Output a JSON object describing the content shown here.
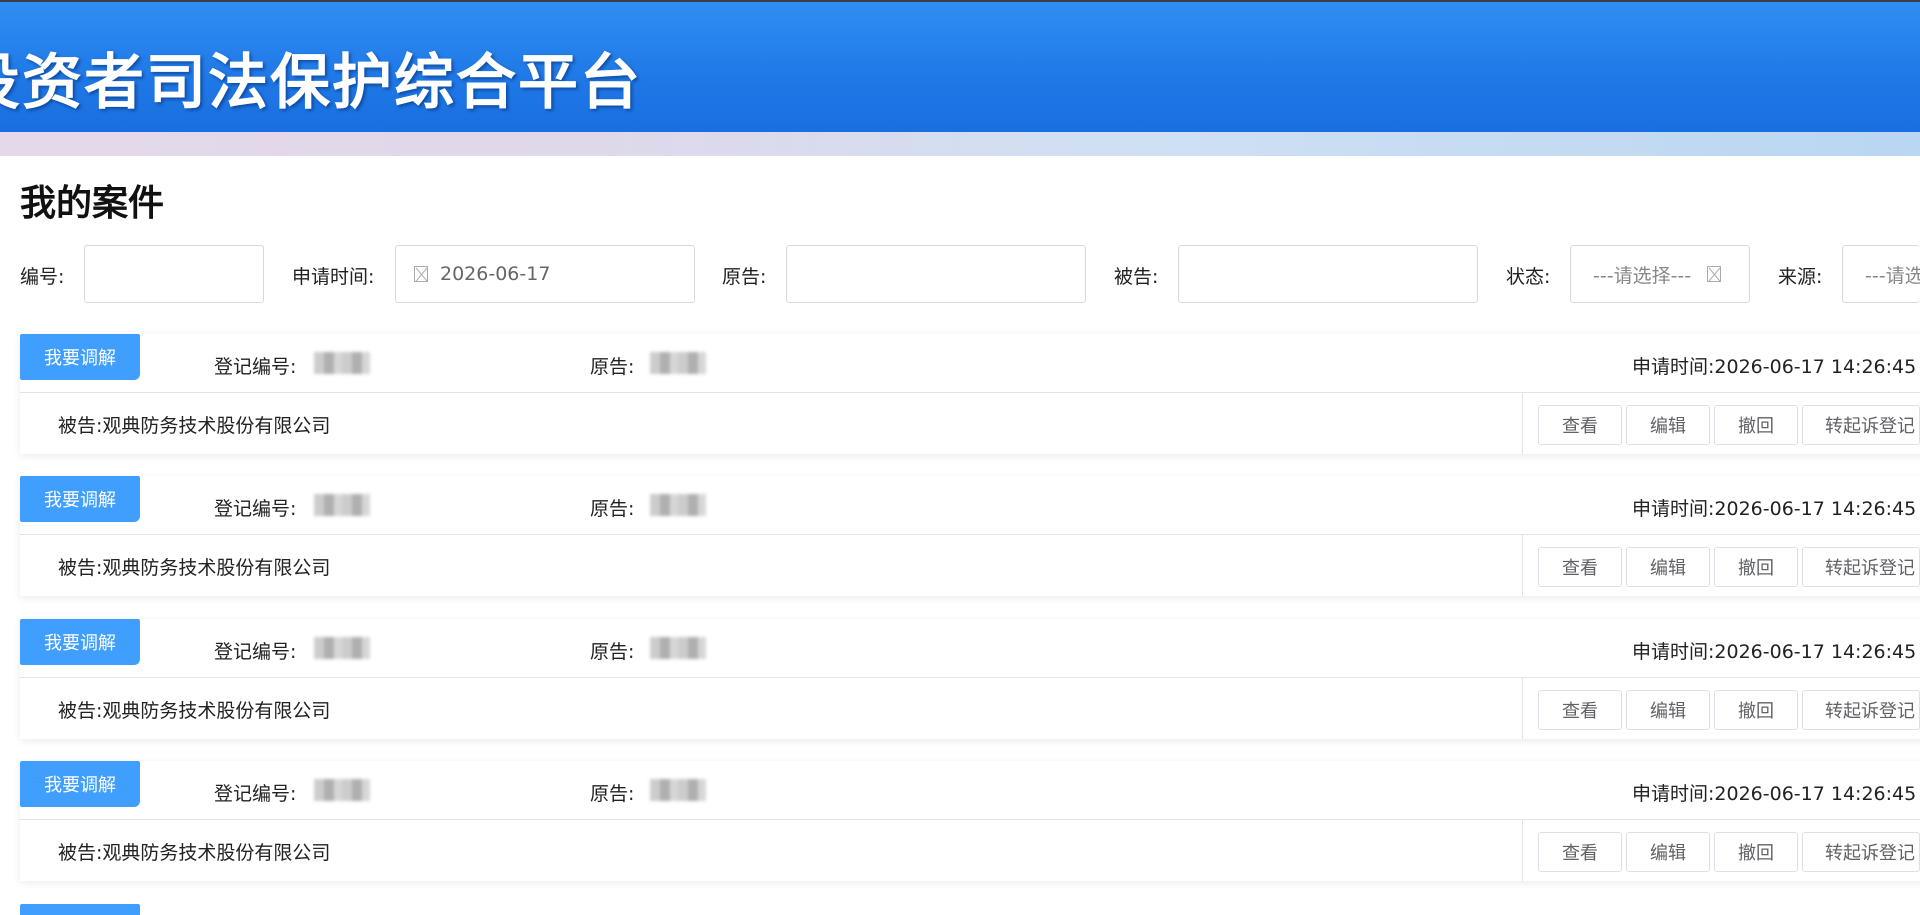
{
  "header": {
    "title": "投资者司法保护综合平台"
  },
  "page_title": "我的案件",
  "filters": {
    "number_label": "编号:",
    "number_value": "",
    "apply_time_label": "申请时间:",
    "apply_time_value": "2026-06-17",
    "plaintiff_label": "原告:",
    "plaintiff_value": "",
    "defendant_label": "被告:",
    "defendant_value": "",
    "status_label": "状态:",
    "status_placeholder": "---请选择---",
    "source_label": "来源:",
    "source_placeholder": "---请选择---"
  },
  "cases": [
    {
      "mediate_label": "我要调解",
      "reg_no_label": "登记编号:",
      "plaintiff_label": "原告:",
      "apply_time_label": "申请时间:",
      "apply_time": "2026-06-17 14:26:45",
      "defendant_label": "被告:",
      "defendant": "观典防务技术股份有限公司",
      "actions": [
        "查看",
        "编辑",
        "撤回",
        "转起诉登记"
      ]
    },
    {
      "mediate_label": "我要调解",
      "reg_no_label": "登记编号:",
      "plaintiff_label": "原告:",
      "apply_time_label": "申请时间:",
      "apply_time": "2026-06-17 14:26:45",
      "defendant_label": "被告:",
      "defendant": "观典防务技术股份有限公司",
      "actions": [
        "查看",
        "编辑",
        "撤回",
        "转起诉登记"
      ]
    },
    {
      "mediate_label": "我要调解",
      "reg_no_label": "登记编号:",
      "plaintiff_label": "原告:",
      "apply_time_label": "申请时间:",
      "apply_time": "2026-06-17 14:26:45",
      "defendant_label": "被告:",
      "defendant": "观典防务技术股份有限公司",
      "actions": [
        "查看",
        "编辑",
        "撤回",
        "转起诉登记"
      ]
    },
    {
      "mediate_label": "我要调解",
      "reg_no_label": "登记编号:",
      "plaintiff_label": "原告:",
      "apply_time_label": "申请时间:",
      "apply_time": "2026-06-17 14:26:45",
      "defendant_label": "被告:",
      "defendant": "观典防务技术股份有限公司",
      "actions": [
        "查看",
        "编辑",
        "撤回",
        "转起诉登记"
      ]
    }
  ],
  "colors": {
    "header_blue": "#1f78e6",
    "mediate_button": "#409eff"
  },
  "icons": {
    "date": "calendar-clear-icon",
    "status_clear": "clear-icon"
  }
}
